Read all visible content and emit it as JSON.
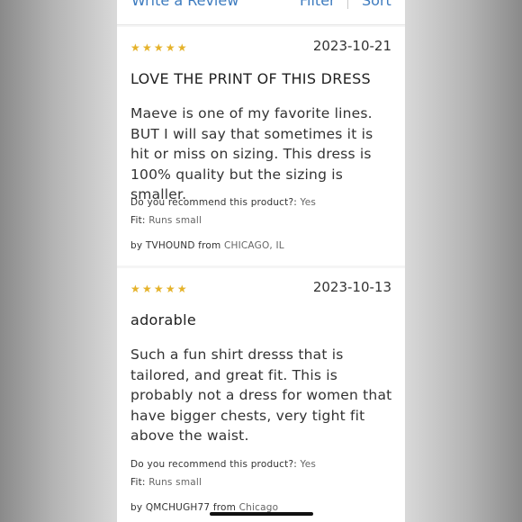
{
  "toolbar": {
    "write_review": "Write a Review",
    "filter": "Filter",
    "sort": "Sort"
  },
  "reviews": [
    {
      "rating": 5,
      "stars": "★★★★★",
      "date": "2023-10-21",
      "title": "LOVE THE PRINT OF THIS DRESS",
      "body": "Maeve is one of my favorite lines. BUT I will say that sometimes it is hit or miss on sizing. This dress is 100% quality but the sizing is smaller.",
      "recommend_label": "Do you recommend this product?:",
      "recommend_value": "Yes",
      "fit_label": "Fit:",
      "fit_value": "Runs small",
      "by_label": "by",
      "author": "TVHOUND",
      "from_label": "from",
      "location": "CHICAGO, IL"
    },
    {
      "rating": 5,
      "stars": "★★★★★",
      "date": "2023-10-13",
      "title": "adorable",
      "body": "Such a fun shirt dresss that is tailored, and great fit. This is probably not a dress for women that have bigger chests, very tight fit above the waist.",
      "recommend_label": "Do you recommend this product?:",
      "recommend_value": "Yes",
      "fit_label": "Fit:",
      "fit_value": "Runs small",
      "by_label": "by",
      "author": "QMCHUGH77",
      "from_label": "from",
      "location": "Chicago"
    }
  ],
  "colors": {
    "star": "#e5b22a",
    "link": "#3d7bbf",
    "text": "#333333"
  }
}
